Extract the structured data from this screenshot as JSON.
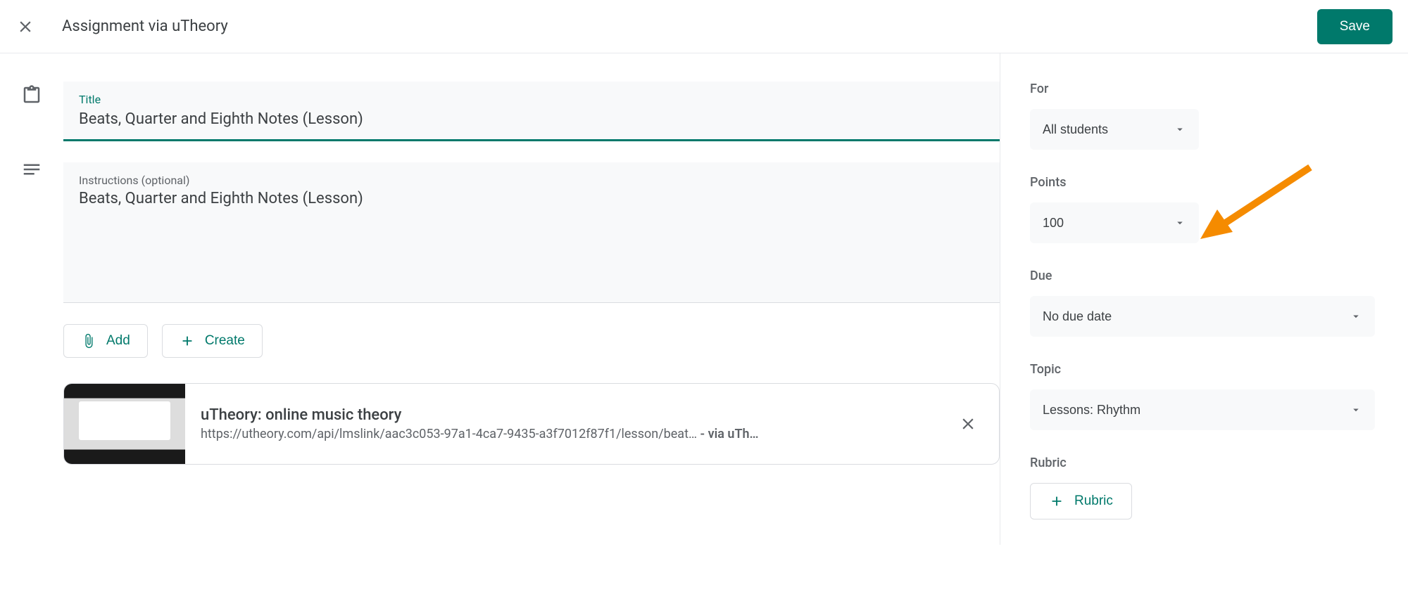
{
  "header": {
    "title": "Assignment via uTheory",
    "save_label": "Save"
  },
  "form": {
    "title_label": "Title",
    "title_value": "Beats, Quarter and Eighth Notes (Lesson)",
    "instructions_label": "Instructions (optional)",
    "instructions_value": "Beats, Quarter and Eighth Notes (Lesson)"
  },
  "actions": {
    "add_label": "Add",
    "create_label": "Create"
  },
  "attachment": {
    "title": "uTheory: online music theory",
    "url_display": "https://utheory.com/api/lmslink/aac3c053-97a1-4ca7-9435-a3f7012f87f1/lesson/beat…",
    "via": " - via uTh…"
  },
  "sidebar": {
    "for": {
      "label": "For",
      "value": "All students"
    },
    "points": {
      "label": "Points",
      "value": "100"
    },
    "due": {
      "label": "Due",
      "value": "No due date"
    },
    "topic": {
      "label": "Topic",
      "value": "Lessons: Rhythm"
    },
    "rubric": {
      "label": "Rubric",
      "button": "Rubric"
    }
  }
}
